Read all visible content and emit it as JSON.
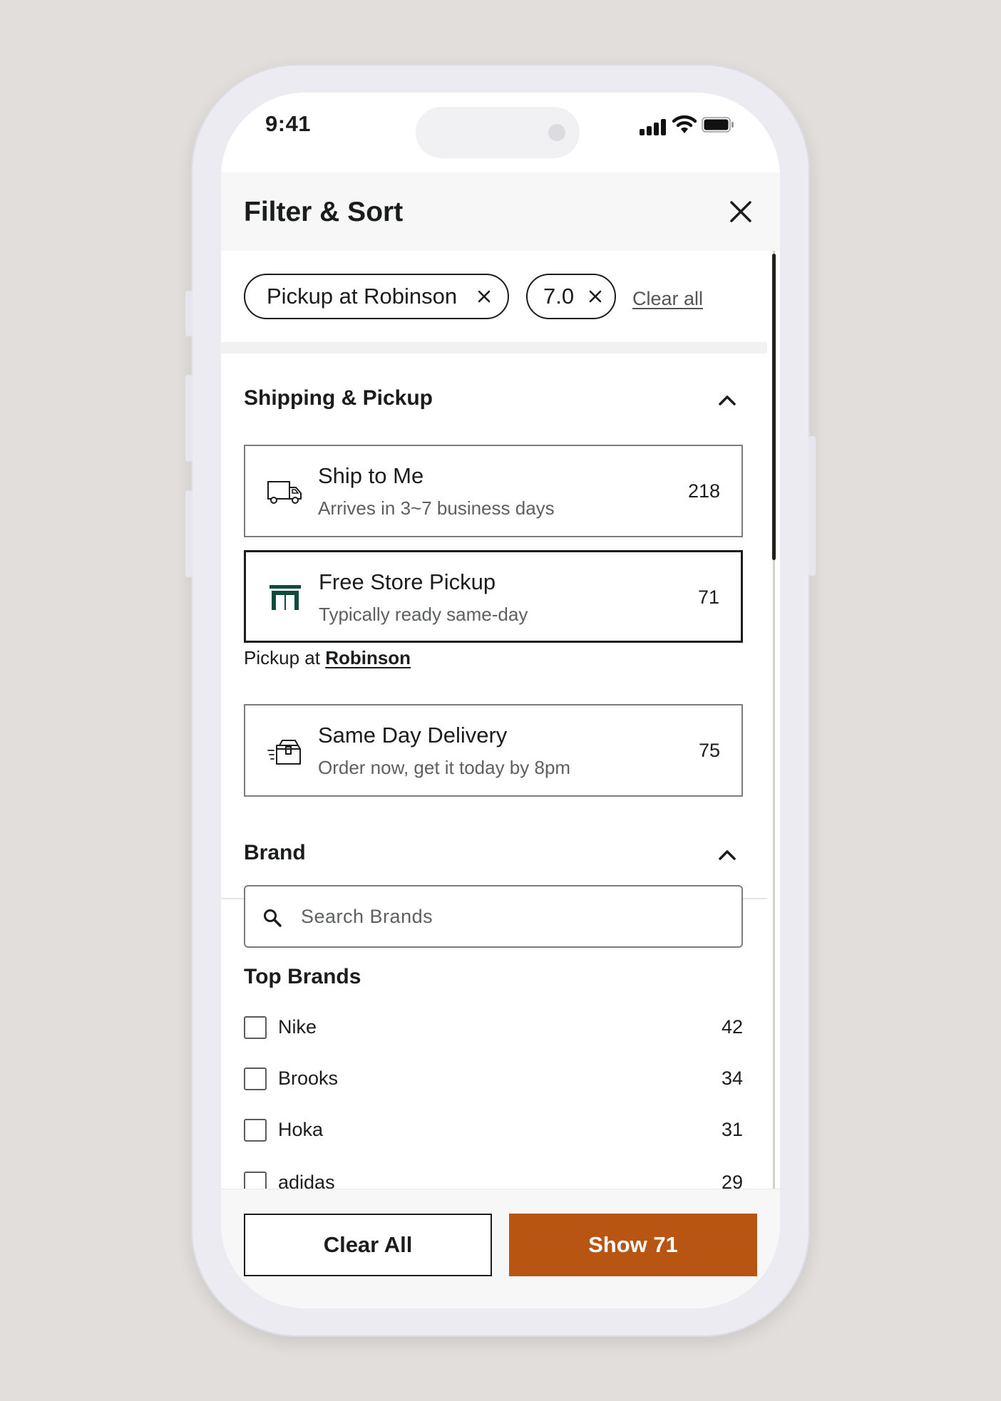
{
  "status_bar": {
    "time": "9:41"
  },
  "header": {
    "title": "Filter & Sort"
  },
  "applied_filters": {
    "chips": [
      {
        "label": "Pickup at Robinson"
      },
      {
        "label": "7.0"
      }
    ],
    "clear_all_label": "Clear all"
  },
  "shipping": {
    "title": "Shipping & Pickup",
    "options": [
      {
        "label": "Ship to Me",
        "sub": "Arrives in 3~7 business days",
        "count": "218",
        "icon": "truck-icon",
        "selected": false
      },
      {
        "label": "Free Store Pickup",
        "sub": "Typically ready same-day",
        "count": "71",
        "icon": "store-icon",
        "selected": true
      },
      {
        "label": "Same Day Delivery",
        "sub": "Order now, get it today by 8pm",
        "count": "75",
        "icon": "delivery-box-icon",
        "selected": false
      }
    ],
    "pickup_prefix": "Pickup at",
    "pickup_store": "Robinson"
  },
  "brand": {
    "title": "Brand",
    "search_placeholder": "Search Brands",
    "top_brands_title": "Top Brands",
    "items": [
      {
        "name": "Nike",
        "count": "42",
        "checked": false
      },
      {
        "name": "Brooks",
        "count": "34",
        "checked": false
      },
      {
        "name": "Hoka",
        "count": "31",
        "checked": false
      },
      {
        "name": "adidas",
        "count": "29",
        "checked": false
      }
    ]
  },
  "footer": {
    "clear_label": "Clear All",
    "show_label": "Show 71"
  },
  "colors": {
    "accent": "#b85512",
    "store_green": "#0f4a3c",
    "text": "#1b1d1c"
  }
}
